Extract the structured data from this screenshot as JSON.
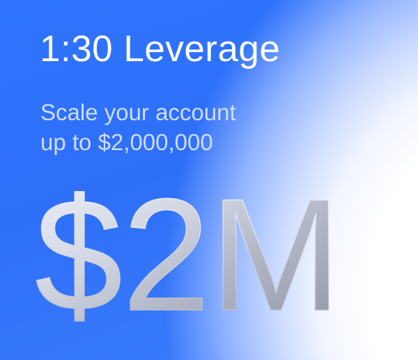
{
  "card": {
    "title": "1:30 Leverage",
    "subtitle_lines": [
      "Scale your account",
      "up to $2,000,000"
    ],
    "big_amount": "$2M"
  },
  "colors": {
    "background_blue": "#2f74ff",
    "glow_white": "#ffffff",
    "subtitle": "#cfdcff",
    "metal_light": "#e9ecf5",
    "metal_dark": "#8e93a4"
  }
}
